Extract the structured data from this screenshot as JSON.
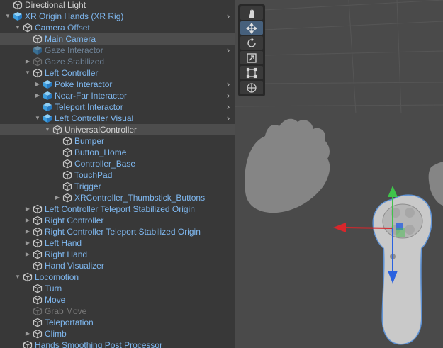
{
  "hierarchy": {
    "items": [
      {
        "label": "Directional Light",
        "depth": 0,
        "arrow": "none",
        "icon": "gameobject",
        "style": "normal",
        "more": false,
        "selected": false
      },
      {
        "label": "XR Origin Hands (XR Rig)",
        "depth": 0,
        "arrow": "open",
        "icon": "prefab",
        "style": "blue",
        "more": true,
        "selected": false
      },
      {
        "label": "Camera Offset",
        "depth": 1,
        "arrow": "open",
        "icon": "gameobject",
        "style": "blue",
        "more": false,
        "selected": false
      },
      {
        "label": "Main Camera",
        "depth": 2,
        "arrow": "none",
        "icon": "gameobject",
        "style": "blue",
        "more": false,
        "selected": true
      },
      {
        "label": "Gaze Interactor",
        "depth": 2,
        "arrow": "none",
        "icon": "prefab",
        "style": "faded",
        "more": true,
        "selected": false
      },
      {
        "label": "Gaze Stabilized",
        "depth": 2,
        "arrow": "closed",
        "icon": "gameobject",
        "style": "faded",
        "more": false,
        "selected": false
      },
      {
        "label": "Left Controller",
        "depth": 2,
        "arrow": "open",
        "icon": "gameobject",
        "style": "blue",
        "more": false,
        "selected": false
      },
      {
        "label": "Poke Interactor",
        "depth": 3,
        "arrow": "closed",
        "icon": "prefab",
        "style": "blue",
        "more": true,
        "selected": false
      },
      {
        "label": "Near-Far Interactor",
        "depth": 3,
        "arrow": "closed",
        "icon": "prefab",
        "style": "blue",
        "more": true,
        "selected": false
      },
      {
        "label": "Teleport Interactor",
        "depth": 3,
        "arrow": "none",
        "icon": "prefab",
        "style": "blue",
        "more": true,
        "selected": false
      },
      {
        "label": "Left Controller Visual",
        "depth": 3,
        "arrow": "open",
        "icon": "prefab",
        "style": "blue",
        "more": true,
        "selected": false
      },
      {
        "label": "UniversalController",
        "depth": 4,
        "arrow": "open",
        "icon": "gameobject",
        "style": "normal",
        "more": false,
        "selected": true
      },
      {
        "label": "Bumper",
        "depth": 5,
        "arrow": "none",
        "icon": "gameobject",
        "style": "blue",
        "more": false,
        "selected": false
      },
      {
        "label": "Button_Home",
        "depth": 5,
        "arrow": "none",
        "icon": "gameobject",
        "style": "blue",
        "more": false,
        "selected": false
      },
      {
        "label": "Controller_Base",
        "depth": 5,
        "arrow": "none",
        "icon": "gameobject",
        "style": "blue",
        "more": false,
        "selected": false
      },
      {
        "label": "TouchPad",
        "depth": 5,
        "arrow": "none",
        "icon": "gameobject",
        "style": "blue",
        "more": false,
        "selected": false
      },
      {
        "label": "Trigger",
        "depth": 5,
        "arrow": "none",
        "icon": "gameobject",
        "style": "blue",
        "more": false,
        "selected": false
      },
      {
        "label": "XRController_Thumbstick_Buttons",
        "depth": 5,
        "arrow": "closed",
        "icon": "gameobject",
        "style": "blue",
        "more": false,
        "selected": false
      },
      {
        "label": "Left Controller Teleport Stabilized Origin",
        "depth": 2,
        "arrow": "closed",
        "icon": "gameobject",
        "style": "blue",
        "more": false,
        "selected": false
      },
      {
        "label": "Right Controller",
        "depth": 2,
        "arrow": "closed",
        "icon": "gameobject",
        "style": "blue",
        "more": false,
        "selected": false
      },
      {
        "label": "Right Controller Teleport Stabilized Origin",
        "depth": 2,
        "arrow": "closed",
        "icon": "gameobject",
        "style": "blue",
        "more": false,
        "selected": false
      },
      {
        "label": "Left Hand",
        "depth": 2,
        "arrow": "closed",
        "icon": "gameobject",
        "style": "blue",
        "more": false,
        "selected": false
      },
      {
        "label": "Right Hand",
        "depth": 2,
        "arrow": "closed",
        "icon": "gameobject",
        "style": "blue",
        "more": false,
        "selected": false
      },
      {
        "label": "Hand Visualizer",
        "depth": 2,
        "arrow": "none",
        "icon": "gameobject",
        "style": "blue",
        "more": false,
        "selected": false
      },
      {
        "label": "Locomotion",
        "depth": 1,
        "arrow": "open",
        "icon": "gameobject",
        "style": "blue",
        "more": false,
        "selected": false
      },
      {
        "label": "Turn",
        "depth": 2,
        "arrow": "none",
        "icon": "gameobject",
        "style": "blue",
        "more": false,
        "selected": false
      },
      {
        "label": "Move",
        "depth": 2,
        "arrow": "none",
        "icon": "gameobject",
        "style": "blue",
        "more": false,
        "selected": false
      },
      {
        "label": "Grab Move",
        "depth": 2,
        "arrow": "none",
        "icon": "gameobject",
        "style": "dim",
        "more": false,
        "selected": false
      },
      {
        "label": "Teleportation",
        "depth": 2,
        "arrow": "none",
        "icon": "gameobject",
        "style": "blue",
        "more": false,
        "selected": false
      },
      {
        "label": "Climb",
        "depth": 2,
        "arrow": "closed",
        "icon": "gameobject",
        "style": "blue",
        "more": false,
        "selected": false
      },
      {
        "label": "Hands Smoothing Post Processor",
        "depth": 1,
        "arrow": "none",
        "icon": "gameobject",
        "style": "blue",
        "more": false,
        "selected": false
      }
    ]
  },
  "scene_view": {
    "tools": [
      {
        "name": "hand-tool",
        "active": false
      },
      {
        "name": "move-tool",
        "active": true
      },
      {
        "name": "rotate-tool",
        "active": false
      },
      {
        "name": "scale-tool",
        "active": false
      },
      {
        "name": "rect-tool",
        "active": false
      },
      {
        "name": "transform-tool",
        "active": false
      }
    ],
    "gizmo_colors": {
      "x": "#d8262b",
      "y": "#3fc34a",
      "z": "#2a62e0"
    },
    "selection_outline_color": "#5f93d6",
    "background_color": "#4a4a4a"
  }
}
